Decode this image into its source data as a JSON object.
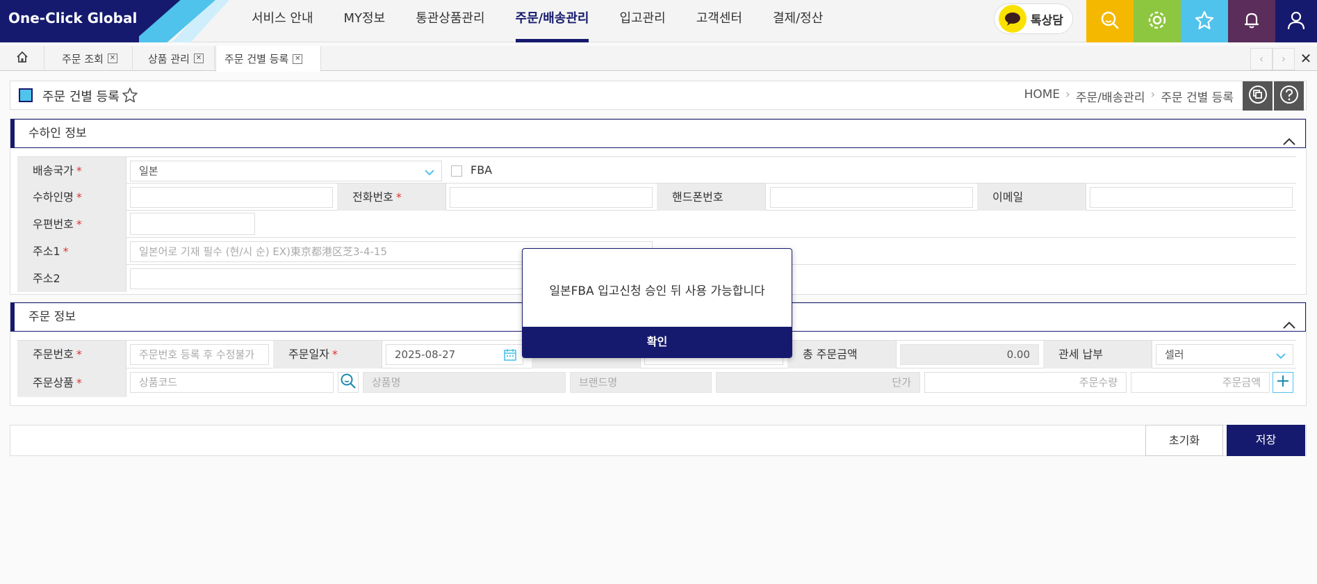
{
  "app": {
    "logo": "One-Click Global"
  },
  "nav": [
    {
      "label": "서비스 안내"
    },
    {
      "label": "MY정보"
    },
    {
      "label": "통관상품관리"
    },
    {
      "label": "주문/배송관리"
    },
    {
      "label": "입고관리"
    },
    {
      "label": "고객센터"
    },
    {
      "label": "결제/정산"
    }
  ],
  "talk": {
    "label": "톡상담"
  },
  "top_buttons": [
    {
      "icon": "search-icon",
      "color": "#f5b800"
    },
    {
      "icon": "settings-icon",
      "color": "#8dc63f"
    },
    {
      "icon": "star-icon",
      "color": "#4fc3ec"
    },
    {
      "icon": "bell-icon",
      "color": "#5a2d5a"
    },
    {
      "icon": "user-icon",
      "color": "#161a6e"
    }
  ],
  "tabs": [
    {
      "label": "주문 조회"
    },
    {
      "label": "상품 관리"
    },
    {
      "label": "주문 건별 등록"
    }
  ],
  "page": {
    "title": "주문 건별 등록",
    "breadcrumb": [
      "HOME",
      "주문/배송관리",
      "주문 건별 등록"
    ]
  },
  "recipient": {
    "section_title": "수하인 정보",
    "country_label": "배송국가",
    "country_value": "일본",
    "fba_label": "FBA",
    "name_label": "수하인명",
    "phone_label": "전화번호",
    "mobile_label": "핸드폰번호",
    "email_label": "이메일",
    "zip_label": "우편번호",
    "addr1_label": "주소1",
    "addr1_placeholder": "일본어로 기재 필수 (현/시 순) EX)東京都港区芝3-4-15",
    "addr2_label": "주소2"
  },
  "order": {
    "section_title": "주문 정보",
    "order_no_label": "주문번호",
    "order_no_placeholder": "주문번호 등록 후 수정불가",
    "order_date_label": "주문일자",
    "order_date_value": "2025-08-27",
    "total_label": "총 주문금액",
    "total_value": "0.00",
    "duty_label": "관세 납부",
    "duty_value": "셀러",
    "product_label": "주문상품",
    "product_code_placeholder": "상품코드",
    "product_name_placeholder": "상품명",
    "brand_placeholder": "브랜드명",
    "unit_price_placeholder": "단가",
    "qty_placeholder": "주문수량",
    "amount_placeholder": "주문금액"
  },
  "actions": {
    "reset": "초기화",
    "save": "저장"
  },
  "modal": {
    "message": "일본FBA 입고신청 승인 뒤 사용 가능합니다",
    "confirm": "확인"
  },
  "colors": {
    "navy": "#161a6e",
    "accent": "#4fc3ec",
    "kakao": "#fae100"
  }
}
